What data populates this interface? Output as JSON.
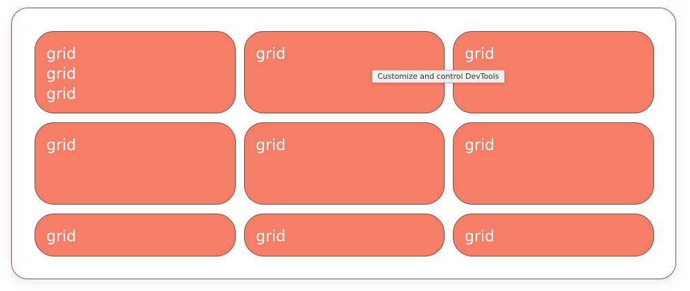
{
  "grid": {
    "cells": [
      {
        "lines": [
          "grid",
          "grid",
          "grid"
        ]
      },
      {
        "lines": [
          "grid"
        ]
      },
      {
        "lines": [
          "grid"
        ]
      },
      {
        "lines": [
          "grid"
        ]
      },
      {
        "lines": [
          "grid"
        ]
      },
      {
        "lines": [
          "grid"
        ]
      },
      {
        "lines": [
          "grid"
        ]
      },
      {
        "lines": [
          "grid"
        ]
      },
      {
        "lines": [
          "grid"
        ]
      }
    ]
  },
  "tooltip": {
    "text": "Customize and control DevTools"
  },
  "colors": {
    "cell_background": "#f67e67",
    "cell_border": "#7a4a4a",
    "container_border": "#8a4b5e"
  }
}
